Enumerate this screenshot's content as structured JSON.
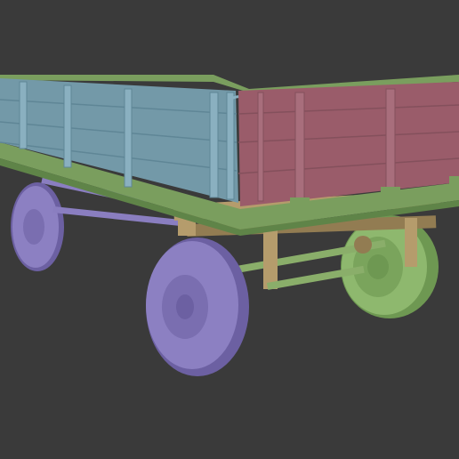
{
  "scene": {
    "subject": "trailer-3d-model",
    "colors": {
      "background": "#3a3a3a",
      "side_panel_blue": "#7399a8",
      "side_panel_blue_dark": "#5f8696",
      "front_panel_pink": "#9a5c6a",
      "front_panel_pink_dark": "#84505c",
      "frame_green": "#7a9e5e",
      "frame_green_dark": "#5f8448",
      "chassis_tan": "#b59c6c",
      "chassis_tan_dark": "#927c52",
      "wheel_purple": "#8c80c2",
      "wheel_purple_dark": "#6c60a2",
      "wheel_green": "#8eb86e",
      "wheel_green_dark": "#6e9852",
      "axle_purple": "#8a7ec0",
      "axle_green": "#8aae6a"
    }
  }
}
